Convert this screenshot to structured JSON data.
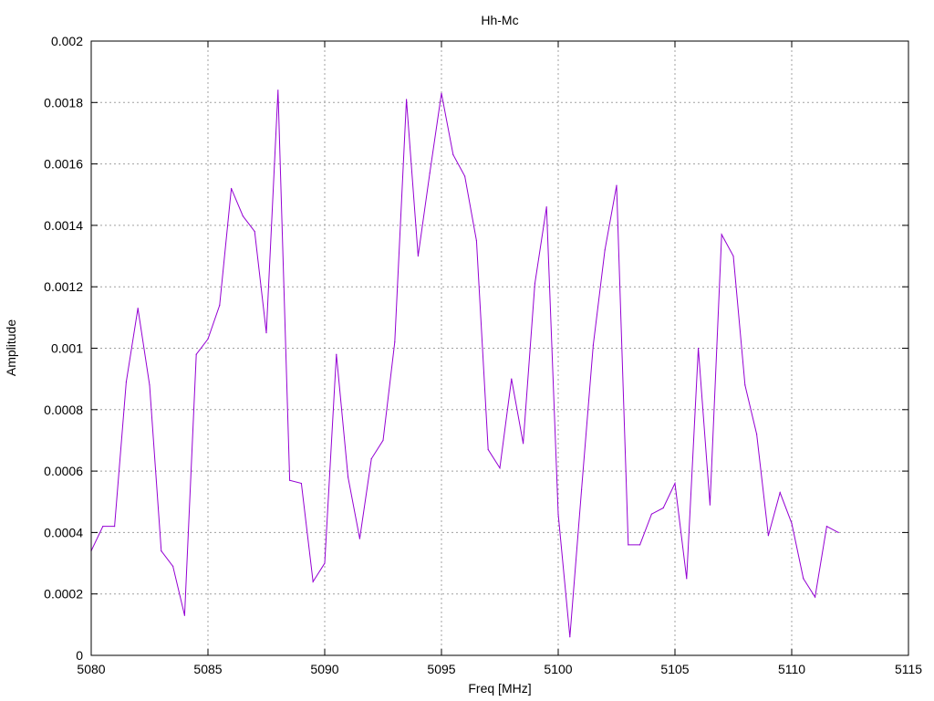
{
  "chart_data": {
    "type": "line",
    "title": "Hh-Mc",
    "xlabel": "Freq [MHz]",
    "ylabel": "Amplitude",
    "xlim": [
      5080,
      5115
    ],
    "ylim": [
      0,
      0.002
    ],
    "x_ticks": [
      5080,
      5085,
      5090,
      5095,
      5100,
      5105,
      5110,
      5115
    ],
    "x_tick_labels": [
      "5080",
      "5085",
      "5090",
      "5095",
      "5100",
      "5105",
      "5110",
      "5115"
    ],
    "y_ticks": [
      0,
      0.0002,
      0.0004,
      0.0006,
      0.0008,
      0.001,
      0.0012,
      0.0014,
      0.0016,
      0.0018,
      0.002
    ],
    "y_tick_labels": [
      "0",
      "0.0002",
      "0.0004",
      "0.0006",
      "0.0008",
      "0.001",
      "0.0012",
      "0.0014",
      "0.0016",
      "0.0018",
      "0.002"
    ],
    "grid": true,
    "legend": "none",
    "series": [
      {
        "color": "#9400d3",
        "x": [
          5080,
          5080.5,
          5081,
          5081.5,
          5082,
          5082.5,
          5083,
          5083.5,
          5084,
          5084.5,
          5085,
          5085.5,
          5086,
          5086.5,
          5087,
          5087.5,
          5088,
          5088.5,
          5089,
          5089.5,
          5090,
          5090.5,
          5091,
          5091.5,
          5092,
          5092.5,
          5093,
          5093.5,
          5094,
          5094.5,
          5095,
          5095.5,
          5096,
          5096.5,
          5097,
          5097.5,
          5098,
          5098.5,
          5099,
          5099.5,
          5100,
          5100.5,
          5101,
          5101.5,
          5102,
          5102.5,
          5103,
          5103.5,
          5104,
          5104.5,
          5105,
          5105.5,
          5106,
          5106.5,
          5107,
          5107.5,
          5108,
          5108.5,
          5109,
          5109.5,
          5110,
          5110.5,
          5111,
          5111.5,
          5112
        ],
        "y": [
          0.00034,
          0.00042,
          0.00042,
          0.00089,
          0.00113,
          0.00088,
          0.00034,
          0.00029,
          0.00013,
          0.00098,
          0.00103,
          0.00114,
          0.00152,
          0.00143,
          0.00138,
          0.00105,
          0.00184,
          0.00057,
          0.00056,
          0.00024,
          0.0003,
          0.00098,
          0.00058,
          0.00038,
          0.00064,
          0.0007,
          0.00102,
          0.00181,
          0.0013,
          0.00157,
          0.00183,
          0.00163,
          0.00156,
          0.00135,
          0.00067,
          0.00061,
          0.0009,
          0.00069,
          0.00121,
          0.00146,
          0.00046,
          6e-05,
          0.00054,
          0.00101,
          0.00132,
          0.00153,
          0.00036,
          0.00036,
          0.00046,
          0.00048,
          0.00056,
          0.00025,
          0.001,
          0.00049,
          0.00137,
          0.0013,
          0.00088,
          0.00072,
          0.00039,
          0.00053,
          0.00043,
          0.00025,
          0.00019,
          0.00042,
          0.0004
        ]
      }
    ]
  }
}
